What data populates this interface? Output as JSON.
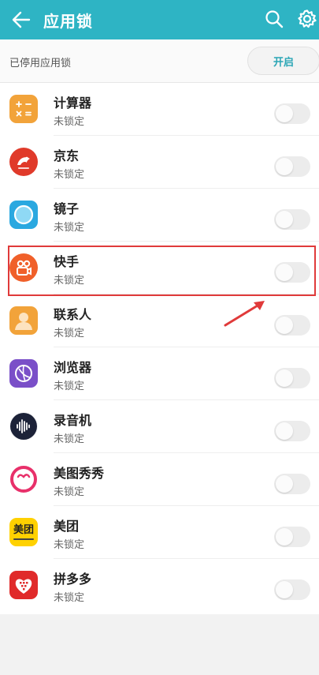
{
  "header": {
    "title": "应用锁"
  },
  "lock_status": {
    "label": "已停用应用锁",
    "enable_button": "开启"
  },
  "apps": [
    {
      "name": "计算器",
      "status": "未锁定",
      "icon": "calculator-icon",
      "color": "#f2a33a"
    },
    {
      "name": "京东",
      "status": "未锁定",
      "icon": "jd-icon",
      "color": "#e03a2a"
    },
    {
      "name": "镜子",
      "status": "未锁定",
      "icon": "mirror-icon",
      "color": "#2aa8e0"
    },
    {
      "name": "快手",
      "status": "未锁定",
      "icon": "kuaishou-icon",
      "color": "#f0602a"
    },
    {
      "name": "联系人",
      "status": "未锁定",
      "icon": "contacts-icon",
      "color": "#f2a33a"
    },
    {
      "name": "浏览器",
      "status": "未锁定",
      "icon": "browser-icon",
      "color": "#7a4fc8"
    },
    {
      "name": "录音机",
      "status": "未锁定",
      "icon": "recorder-icon",
      "color": "#1c2238"
    },
    {
      "name": "美图秀秀",
      "status": "未锁定",
      "icon": "meitu-icon",
      "color": "#e8306a"
    },
    {
      "name": "美团",
      "status": "未锁定",
      "icon": "meituan-icon",
      "color": "#ffd100"
    },
    {
      "name": "拼多多",
      "status": "未锁定",
      "icon": "pinduoduo-icon",
      "color": "#e02a2a"
    }
  ],
  "meituan_icon_text": "美团"
}
